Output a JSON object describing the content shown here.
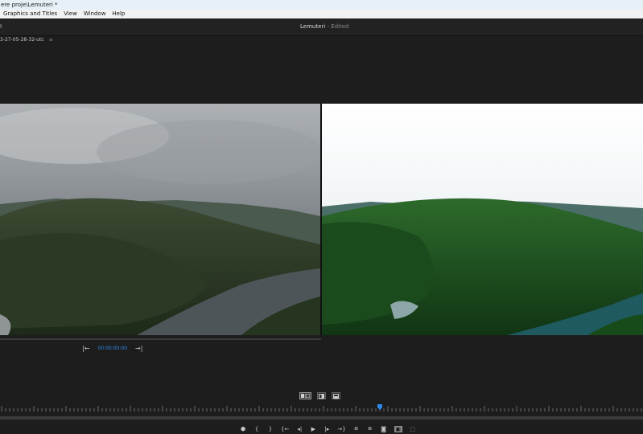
{
  "window": {
    "title": "ere proje\\Lemuteri *"
  },
  "menu": [
    "Graphics and Titles",
    "View",
    "Window",
    "Help"
  ],
  "header": {
    "left_label": "t",
    "title": "Lemuteri",
    "title_suffix": " - Edited"
  },
  "sequence": {
    "name": "3-27-05-28-32-utc",
    "menu_glyph": "≡"
  },
  "program": {
    "timecode": "00:00:00:00",
    "go_in_glyph": "|←",
    "go_out_glyph": "→|"
  },
  "transport_glyphs": [
    "⬢",
    "{",
    "}",
    "{←",
    "◂|",
    "▶",
    "|▸",
    "→}",
    "⧈",
    "⧈",
    "◙",
    "▣",
    "⬚"
  ],
  "colors": {
    "accent": "#2d8ceb",
    "playhead": "#2d8ceb"
  },
  "compare": {
    "playhead_fraction": 0.59
  }
}
